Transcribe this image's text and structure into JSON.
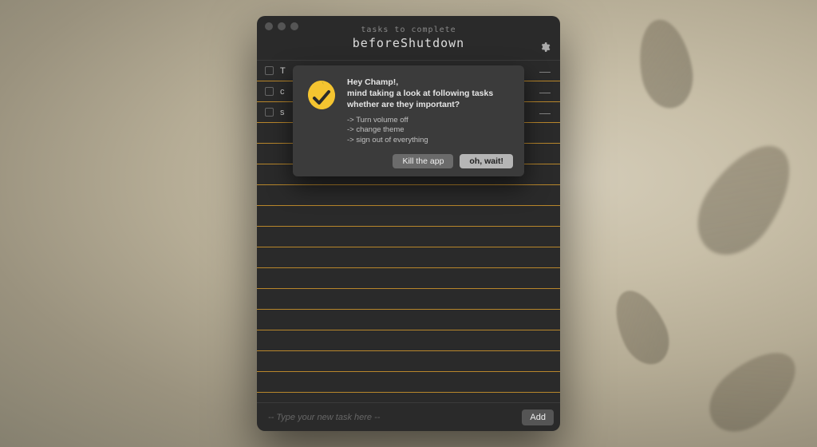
{
  "header": {
    "subtitle": "tasks to complete",
    "title": "beforeShutdown"
  },
  "tasks": [
    {
      "label": "T"
    },
    {
      "label": "c"
    },
    {
      "label": "s"
    }
  ],
  "emptyRowCount": 13,
  "input": {
    "placeholder": "-- Type your new task here --",
    "addLabel": "Add"
  },
  "dialog": {
    "greeting": "Hey Champ!,",
    "line1": "mind taking a look at following tasks",
    "line2": "whether are they important?",
    "pending": [
      "Turn volume off",
      "change theme",
      "sign out of everything"
    ],
    "killLabel": "Kill the app",
    "waitLabel": "oh, wait!"
  },
  "colors": {
    "ruleLine": "#b8862b",
    "windowBg": "#2a2a2a",
    "dialogBg": "#3b3b3b",
    "iconYellow": "#f4c430"
  }
}
